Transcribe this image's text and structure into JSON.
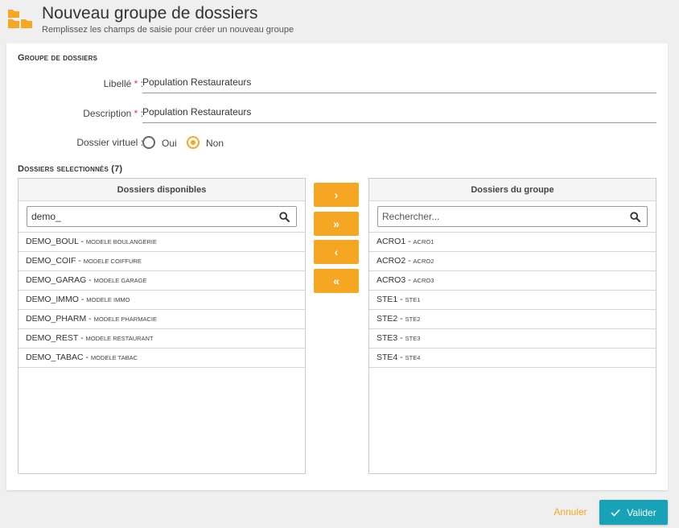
{
  "header": {
    "title": "Nouveau groupe de dossiers",
    "subtitle": "Remplissez les champs de saisie pour créer un nouveau groupe",
    "icon": "folders-icon"
  },
  "group_section": {
    "title": "Groupe de dossiers",
    "libelle_label": "Libellé",
    "libelle_value": "Population Restaurateurs",
    "description_label": "Description",
    "description_value": "Population Restaurateurs",
    "required_mark": "*",
    "colon": ":",
    "virtual_label": "Dossier virtuel :",
    "virtual_options": [
      {
        "label": "Oui",
        "checked": false
      },
      {
        "label": "Non",
        "checked": true
      }
    ]
  },
  "selected_section": {
    "title": "Dossiers selectionnés (7)"
  },
  "available": {
    "header": "Dossiers disponibles",
    "search_value": "demo_",
    "items": [
      {
        "code": "DEMO_BOUL",
        "sep": " - ",
        "name": "Modele boulangerie"
      },
      {
        "code": "DEMO_COIF",
        "sep": " - ",
        "name": "Modele coiffure"
      },
      {
        "code": "DEMO_GARAG",
        "sep": " - ",
        "name": "Modele garage"
      },
      {
        "code": "DEMO_IMMO",
        "sep": " - ",
        "name": "Modele immo"
      },
      {
        "code": "DEMO_PHARM",
        "sep": " - ",
        "name": "Modele pharmacie"
      },
      {
        "code": "DEMO_REST",
        "sep": " - ",
        "name": "Modele restaurant"
      },
      {
        "code": "DEMO_TABAC",
        "sep": " - ",
        "name": "Modele tabac"
      }
    ]
  },
  "group": {
    "header": "Dossiers du groupe",
    "search_placeholder": "Rechercher...",
    "items": [
      {
        "code": "ACRO1",
        "sep": " - ",
        "name": "acro1"
      },
      {
        "code": "ACRO2",
        "sep": " - ",
        "name": "acro2"
      },
      {
        "code": "ACRO3",
        "sep": " - ",
        "name": "acro3"
      },
      {
        "code": "STE1",
        "sep": " - ",
        "name": "ste1"
      },
      {
        "code": "STE2",
        "sep": " - ",
        "name": "ste2"
      },
      {
        "code": "STE3",
        "sep": " - ",
        "name": "ste3"
      },
      {
        "code": "STE4",
        "sep": " - ",
        "name": "ste4"
      }
    ]
  },
  "transfer": {
    "move_right": "›",
    "move_all_right": "»",
    "move_left": "‹",
    "move_all_left": "«"
  },
  "footer": {
    "cancel_label": "Annuler",
    "validate_label": "Valider"
  },
  "colors": {
    "accent": "#f5a623",
    "primary": "#17a2b8",
    "required": "#e53935"
  }
}
